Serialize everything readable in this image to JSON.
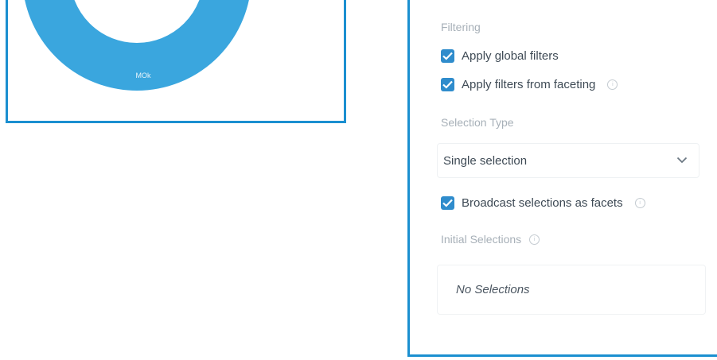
{
  "chart_widget": {
    "donut_label": "MOk",
    "ring_color": "#3aa6de",
    "border_color": "#1b8fd0"
  },
  "properties": {
    "filtering": {
      "section_label": "Filtering",
      "apply_global_filters": {
        "label": "Apply global filters",
        "checked": true
      },
      "apply_faceting_filters": {
        "label": "Apply filters from faceting",
        "checked": true,
        "info_icon": "info-icon"
      }
    },
    "selection_type": {
      "section_label": "Selection Type",
      "selected_value": "Single selection",
      "dropdown_icon": "chevron-down-icon"
    },
    "broadcast": {
      "label": "Broadcast selections as facets",
      "checked": true,
      "info_icon": "info-icon"
    },
    "initial_selections": {
      "section_label": "Initial Selections",
      "info_icon": "info-icon",
      "value": "No Selections"
    },
    "checkbox_color": "#2f8ccc",
    "label_color": "#a7b0b8"
  }
}
